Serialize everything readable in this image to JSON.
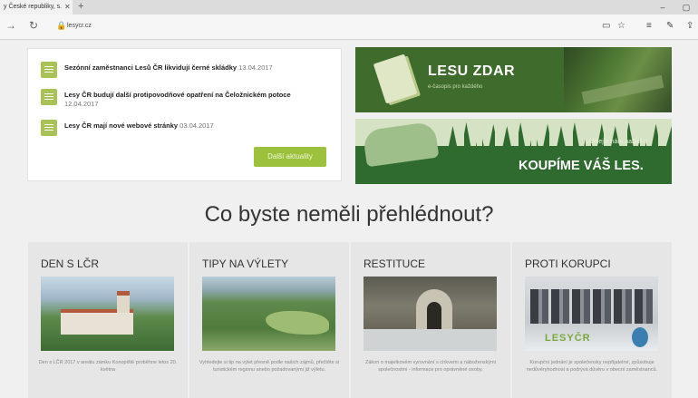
{
  "browser": {
    "tab_title": "y České republiky, s.",
    "url": "lesycr.cz",
    "icons": [
      "close-icon",
      "new-tab-icon",
      "back-icon",
      "forward-icon",
      "refresh-icon",
      "lock-icon",
      "reading-view-icon",
      "favorite-star-icon",
      "hub-icon",
      "notes-icon",
      "share-icon"
    ]
  },
  "news": {
    "items": [
      {
        "title": "Sezónní zaměstnanci Lesů ČR likvidují černé skládky",
        "date": "13.04.2017"
      },
      {
        "title": "Lesy ČR budují další protipovodňové opatření na Čeložnickém potoce",
        "date": "12.04.2017"
      },
      {
        "title": "Lesy ČR mají nové webové stránky",
        "date": "03.04.2017"
      }
    ],
    "more_label": "Další aktuality"
  },
  "banners": {
    "lesu_zdar": {
      "title": "LESU ZDAR",
      "subtitle": "e-časopis pro každého"
    },
    "koupime": {
      "subtitle": "Udělejte nám nabídku.",
      "title": "KOUPÍME VÁŠ LES."
    }
  },
  "section": {
    "title": "Co byste neměli přehlédnout?"
  },
  "cards": [
    {
      "title": "DEN S LČR",
      "desc": "Den s LČR 2017 v areálu zámku Konopiště proběhne letos 20. května"
    },
    {
      "title": "TIPY NA VÝLETY",
      "desc": "Vyhledejte si tip na výlet přesně podle našich zájmů, přečtěte si turistickém regionu anebo požadovanými již výletu."
    },
    {
      "title": "RESTITUCE",
      "desc": "Zákon o majetkovém vyrovnání s církvemi a náboženskými společnostmi - informace pro oprávněné osoby."
    },
    {
      "title": "PROTI KORUPCI",
      "desc": "Korupční jednání je společensky nepřijatelné, způsobuje nedůvěryhodnost a podrývá důvěru v obecní zaměstnanců."
    }
  ],
  "korupce_logo": "LESYČR",
  "colors": {
    "accent_green": "#9cc13c",
    "banner_dark": "#3f6b2c",
    "forest": "#2f6a2f"
  }
}
